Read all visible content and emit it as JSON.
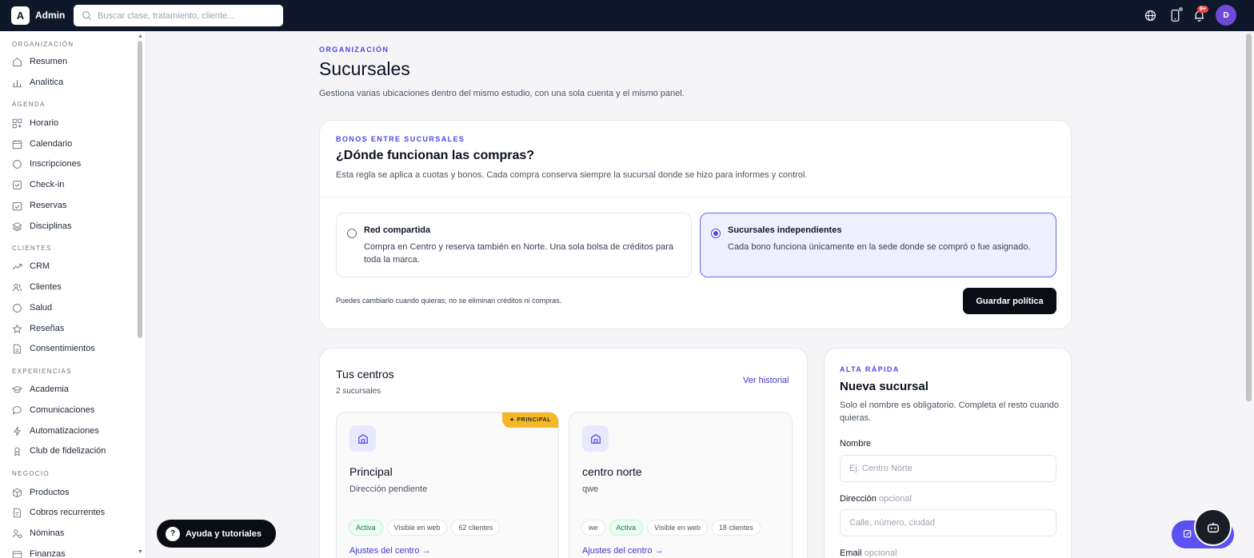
{
  "app": {
    "logo_letter": "A",
    "name": "Admin"
  },
  "search": {
    "placeholder": "Buscar clase, tratamiento, cliente..."
  },
  "header": {
    "notifications_badge": "9+",
    "avatar_initial": "D"
  },
  "sidebar": {
    "sections": [
      {
        "label": "ORGANIZACIÓN",
        "items": [
          {
            "label": "Resumen",
            "icon": "home-icon"
          },
          {
            "label": "Analítica",
            "icon": "bar-chart-icon"
          }
        ]
      },
      {
        "label": "AGENDA",
        "items": [
          {
            "label": "Horario",
            "icon": "grid-plus-icon"
          },
          {
            "label": "Calendario",
            "icon": "calendar-icon"
          },
          {
            "label": "Inscripciones",
            "icon": "circle-icon"
          },
          {
            "label": "Check-in",
            "icon": "check-square-icon"
          },
          {
            "label": "Reservas",
            "icon": "calendar-check-icon"
          },
          {
            "label": "Disciplinas",
            "icon": "layers-icon"
          }
        ]
      },
      {
        "label": "CLIENTES",
        "items": [
          {
            "label": "CRM",
            "icon": "trend-icon"
          },
          {
            "label": "Clientes",
            "icon": "users-icon"
          },
          {
            "label": "Salud",
            "icon": "circle-icon"
          },
          {
            "label": "Reseñas",
            "icon": "star-icon"
          },
          {
            "label": "Consentimientos",
            "icon": "document-icon"
          }
        ]
      },
      {
        "label": "EXPERIENCIAS",
        "items": [
          {
            "label": "Academia",
            "icon": "graduation-cap-icon"
          },
          {
            "label": "Comunicaciones",
            "icon": "chat-bubble-icon"
          },
          {
            "label": "Automatizaciones",
            "icon": "lightning-icon"
          },
          {
            "label": "Club de fidelización",
            "icon": "gift-icon"
          }
        ]
      },
      {
        "label": "NEGOCIO",
        "items": [
          {
            "label": "Productos",
            "icon": "box-icon"
          },
          {
            "label": "Cobros recurrentes",
            "icon": "receipt-icon"
          },
          {
            "label": "Nóminas",
            "icon": "user-money-icon"
          },
          {
            "label": "Finanzas",
            "icon": "wallet-icon"
          }
        ]
      }
    ]
  },
  "page": {
    "eyebrow": "ORGANIZACIÓN",
    "title": "Sucursales",
    "subtitle": "Gestiona varias ubicaciones dentro del mismo estudio, con una sola cuenta y el mismo panel."
  },
  "policy_card": {
    "eyebrow": "BONOS ENTRE SUCURSALES",
    "title": "¿Dónde funcionan las compras?",
    "subtitle": "Esta regla se aplica a cuotas y bonos. Cada compra conserva siempre la sucursal donde se hizo para informes y control.",
    "options": [
      {
        "title": "Red compartida",
        "description": "Compra en Centro y reserva también en Norte. Una sola bolsa de créditos para toda la marca.",
        "selected": false
      },
      {
        "title": "Sucursales independientes",
        "description": "Cada bono funciona únicamente en la sede donde se compró o fue asignado.",
        "selected": true
      }
    ],
    "note": "Puedes cambiarlo cuando quieras; no se eliminan créditos ni compras.",
    "save_label": "Guardar política"
  },
  "centers_card": {
    "title": "Tus centros",
    "count": "2 sucursales",
    "history_link": "Ver historial",
    "branches": [
      {
        "name": "Principal",
        "address": "Dirección pendiente",
        "tag": "★ PRINCIPAL",
        "chips": [
          "Activa",
          "Visible en web",
          "62 clientes"
        ],
        "settings_link": "Ajustes del centro →"
      },
      {
        "name": "centro norte",
        "address": "qwe",
        "chips": [
          "we",
          "Activa",
          "Visible en web",
          "18 clientes"
        ],
        "settings_link": "Ajustes del centro →"
      }
    ]
  },
  "new_branch_card": {
    "eyebrow": "ALTA RÁPIDA",
    "title": "Nueva sucursal",
    "subtitle": "Solo el nombre es obligatorio. Completa el resto cuando quieras.",
    "name_label": "Nombre",
    "name_placeholder": "Ej. Centro Norte",
    "address_label": "Dirección",
    "address_optional": "opcional",
    "address_placeholder": "Calle, número, ciudad",
    "email_label": "Email",
    "email_optional": "opcional"
  },
  "help": {
    "icon_char": "?",
    "label": "Ayuda y tutoriales"
  },
  "colors": {
    "accent": "#4f46e5",
    "topbar": "#0f172a",
    "principal_tag": "#f5b726",
    "active_green": "#15803d"
  }
}
